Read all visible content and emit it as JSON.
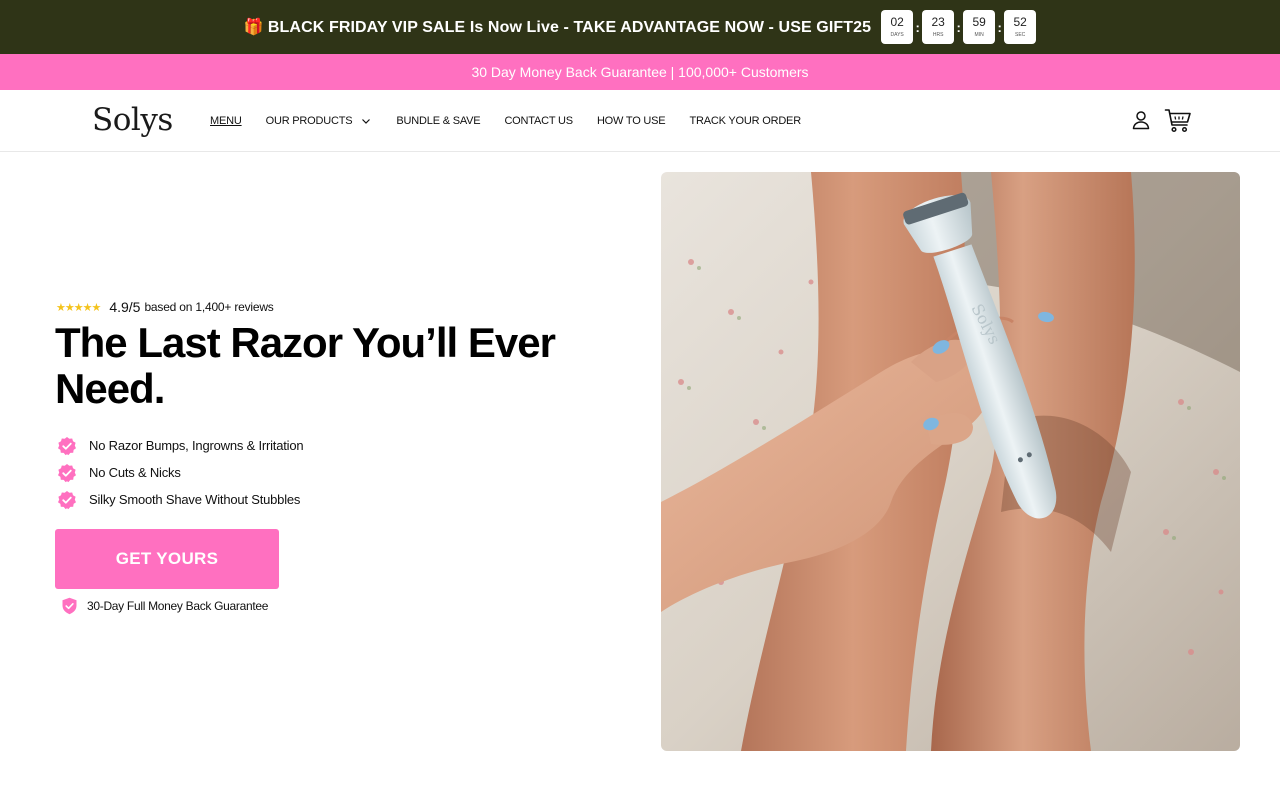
{
  "topbar": {
    "gift_emoji": "🎁",
    "announcement": "BLACK FRIDAY VIP SALE Is Now Live - TAKE ADVANTAGE NOW - USE GIFT25",
    "countdown": [
      {
        "value": "02",
        "unit": "DAYS"
      },
      {
        "value": "23",
        "unit": "HRS"
      },
      {
        "value": "59",
        "unit": "MIN"
      },
      {
        "value": "52",
        "unit": "SEC"
      }
    ],
    "separator": ":"
  },
  "pinkbar": {
    "text": "30 Day Money Back Guarantee | 100,000+ Customers"
  },
  "header": {
    "logo": "Solys",
    "nav": [
      {
        "label": "MENU"
      },
      {
        "label": "OUR PRODUCTS"
      },
      {
        "label": "BUNDLE & SAVE"
      },
      {
        "label": "CONTACT US"
      },
      {
        "label": "HOW TO USE"
      },
      {
        "label": "TRACK YOUR ORDER"
      }
    ]
  },
  "hero": {
    "stars": "★★★★★",
    "rating_score": "4.9/5",
    "rating_text": "based on  1,400+ reviews",
    "title": "The Last Razor You’ll Ever Need.",
    "benefits": [
      "No Razor Bumps, Ingrowns & Irritation",
      "No Cuts & Nicks",
      "Silky Smooth Shave Without Stubbles"
    ],
    "cta_label": "GET YOURS",
    "guarantee": "30-Day Full Money Back Guarantee",
    "product_engraving": "Solys"
  },
  "colors": {
    "topbar_bg": "#2f3417",
    "accent_pink": "#ff70c0",
    "star_yellow": "#f4c31c"
  },
  "icons": {
    "account": "user-icon",
    "cart": "cart-icon",
    "benefit_badge": "check-badge-icon",
    "guarantee": "shield-check-icon",
    "dropdown": "chevron-down-icon"
  }
}
